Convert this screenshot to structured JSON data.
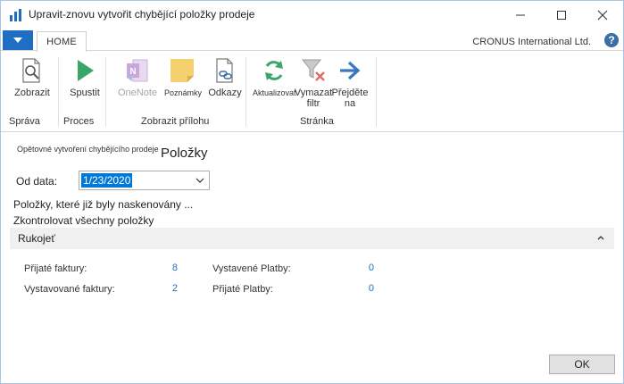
{
  "window": {
    "title": "Upravit-znovu vytvořit chybějící položky prodeje"
  },
  "ribbon_tabs": {
    "home_label": "HOME",
    "company": "CRONUS International Ltd."
  },
  "ribbon": {
    "buttons": [
      {
        "label": "Zobrazit",
        "icon": "view-icon"
      },
      {
        "label": "Spustit",
        "icon": "play-icon"
      },
      {
        "label": "OneNote",
        "icon": "onenote-icon",
        "enabled": false
      },
      {
        "label": "Poznámky",
        "icon": "note-icon"
      },
      {
        "label": "Odkazy",
        "icon": "link-icon"
      },
      {
        "label": "Aktualizovat",
        "icon": "refresh-icon"
      },
      {
        "label": "Vymazat filtr",
        "icon": "clear-filter-icon"
      },
      {
        "label": "Přejděte na",
        "icon": "arrow-right-icon"
      }
    ],
    "groups": {
      "sprava": "Správa",
      "proces": "Proces",
      "priloha": "Zobrazit přílohu",
      "stranka": "Stránka"
    }
  },
  "page": {
    "caption": "Opětovné vytvoření chybějícího prodeje",
    "title": "Položky",
    "from_date_label": "Od data:",
    "from_date_value": "1/23/2020",
    "info_scanned": "Položky, které již byly naskenovány ...",
    "info_check_all": "Zkontrolovat všechny položky"
  },
  "fasttab": {
    "label": "Rukojeť",
    "stats": [
      {
        "label": "Přijaté faktury:",
        "value": "8"
      },
      {
        "label": "Vystavované faktury:",
        "value": "2"
      },
      {
        "label": "Vystavené Platby:",
        "value": "0"
      },
      {
        "label": "Přijaté Platby:",
        "value": "0"
      }
    ]
  },
  "footer": {
    "ok_label": "OK"
  },
  "colors": {
    "accent": "#1e6fc3",
    "selection": "#0078d7",
    "play": "#3aa66a",
    "refresh": "#3aa66a"
  }
}
